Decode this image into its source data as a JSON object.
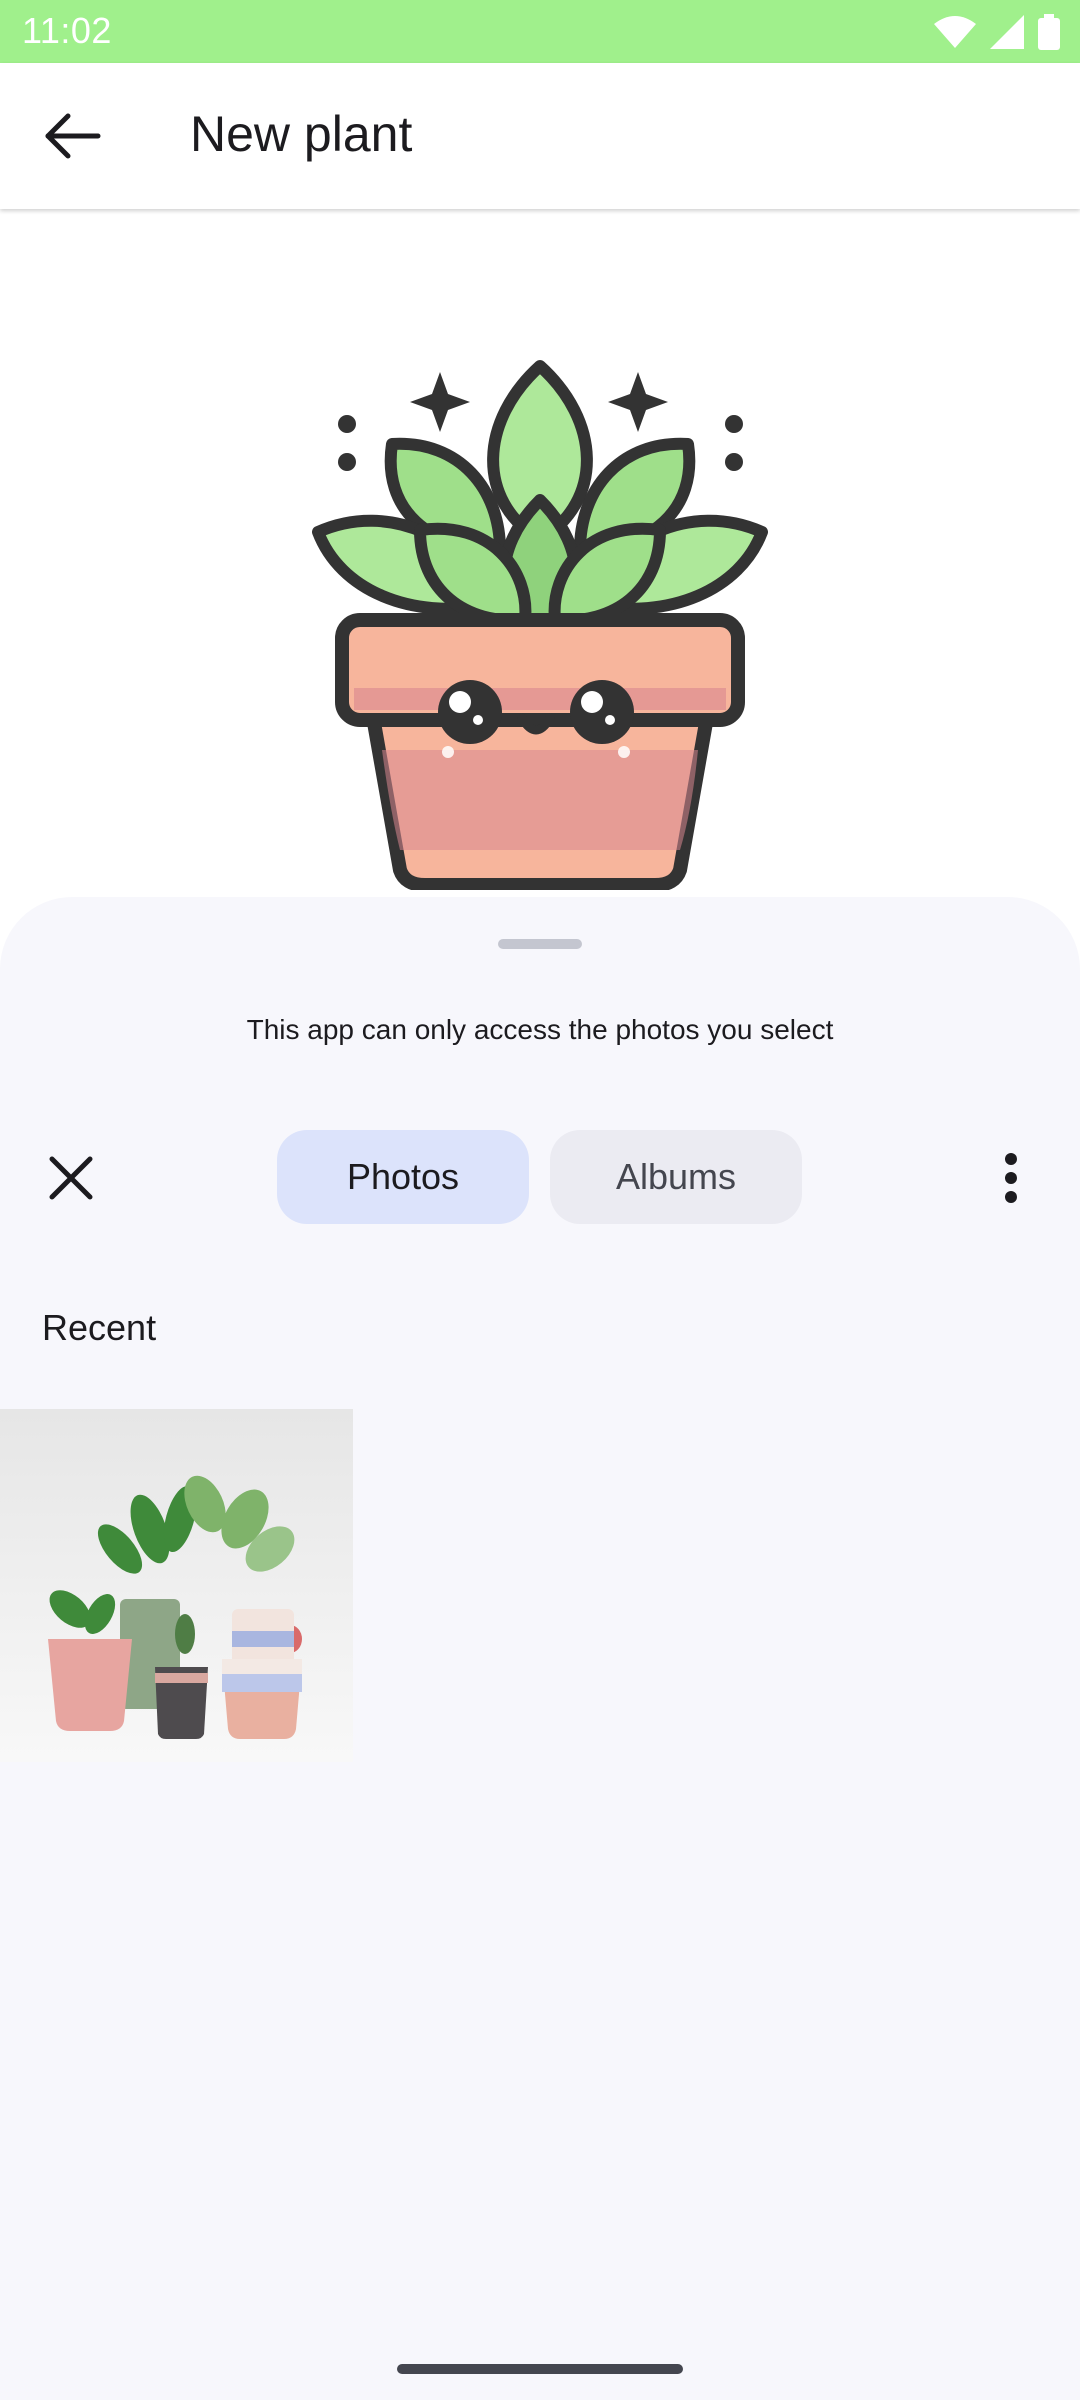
{
  "status_bar": {
    "time": "11:02",
    "icons": [
      "wifi-icon",
      "signal-icon",
      "battery-icon"
    ]
  },
  "app_bar": {
    "title": "New plant",
    "back_icon": "arrow-back-icon"
  },
  "hero_image": {
    "icon": "potted-plant-illustration"
  },
  "photo_picker": {
    "notice": "This app can only access the photos you select",
    "close_icon": "close-icon",
    "tabs": [
      {
        "label": "Photos",
        "selected": true
      },
      {
        "label": "Albums",
        "selected": false
      }
    ],
    "more_icon": "more-vert-icon",
    "section_title": "Recent",
    "photos": [
      {
        "subject": "potted-plants-photo"
      }
    ]
  },
  "colors": {
    "status_bar": "#a0f08c",
    "sheet_background": "#f7f7fc",
    "selected_tab": "#dce3fb",
    "unselected_tab": "#ebebf2"
  }
}
